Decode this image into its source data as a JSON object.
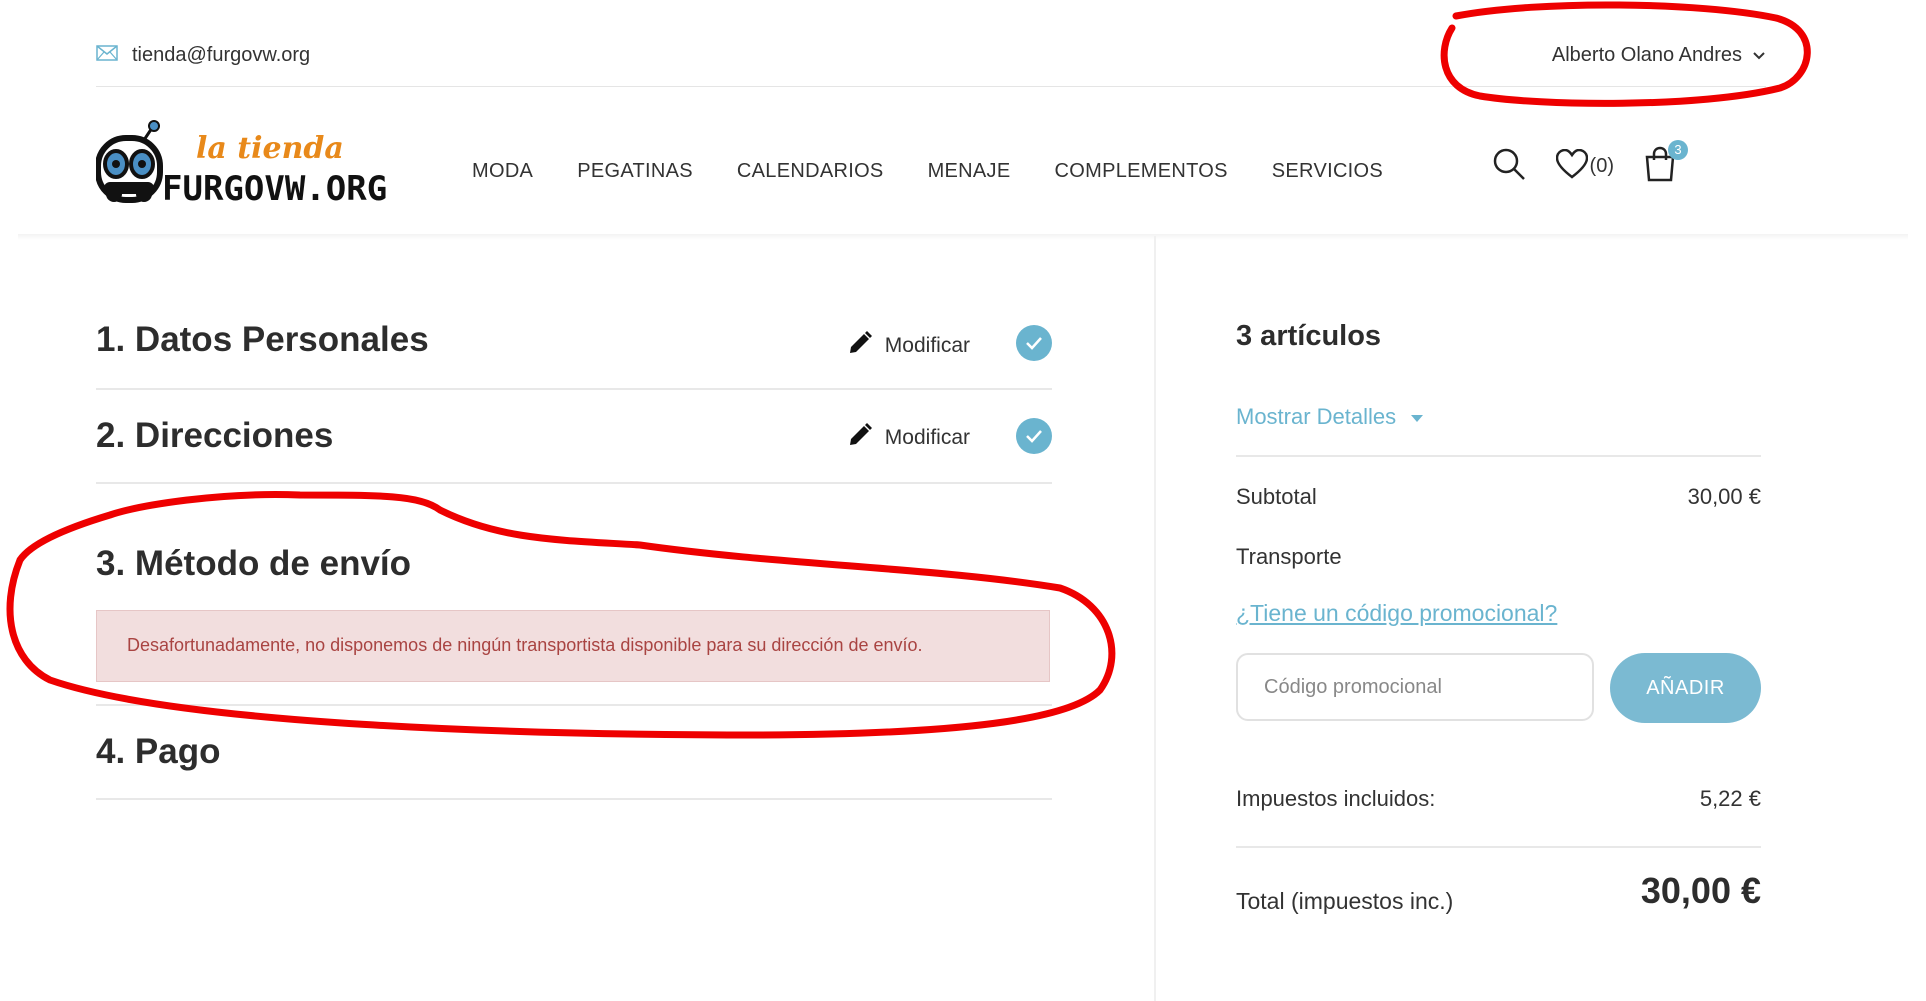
{
  "topbar": {
    "email": "tienda@furgovw.org",
    "user_name": "Alberto Olano Andres"
  },
  "logo": {
    "line1": "la tienda",
    "line2": "FURGOVW.ORG"
  },
  "nav": {
    "items": [
      "MODA",
      "PEGATINAS",
      "CALENDARIOS",
      "MENAJE",
      "COMPLEMENTOS",
      "SERVICIOS"
    ],
    "wishlist_count": "(0)",
    "cart_count": "3"
  },
  "checkout": {
    "steps": [
      {
        "title": "1. Datos Personales",
        "action": "Modificar",
        "done": true
      },
      {
        "title": "2. Direcciones",
        "action": "Modificar",
        "done": true
      },
      {
        "title": "3. Método de envío",
        "alert": "Desafortunadamente, no disponemos de ningún transportista disponible para su dirección de envío."
      },
      {
        "title": "4. Pago"
      }
    ]
  },
  "summary": {
    "items_count": "3 artículos",
    "show_details": "Mostrar Detalles",
    "subtotal_label": "Subtotal",
    "subtotal_value": "30,00 €",
    "shipping_label": "Transporte",
    "promo_link": "¿Tiene un código promocional?",
    "promo_placeholder": "Código promocional",
    "promo_button": "AÑADIR",
    "taxes_label": "Impuestos incluidos:",
    "taxes_value": "5,22 €",
    "total_label": "Total (impuestos inc.)",
    "total_value": "30,00 €"
  },
  "colors": {
    "accent": "#6ab4cf",
    "alert_bg": "#f2dede",
    "alert_text": "#a94442",
    "annotation": "#ee0000",
    "logo_orange": "#e8891a"
  }
}
